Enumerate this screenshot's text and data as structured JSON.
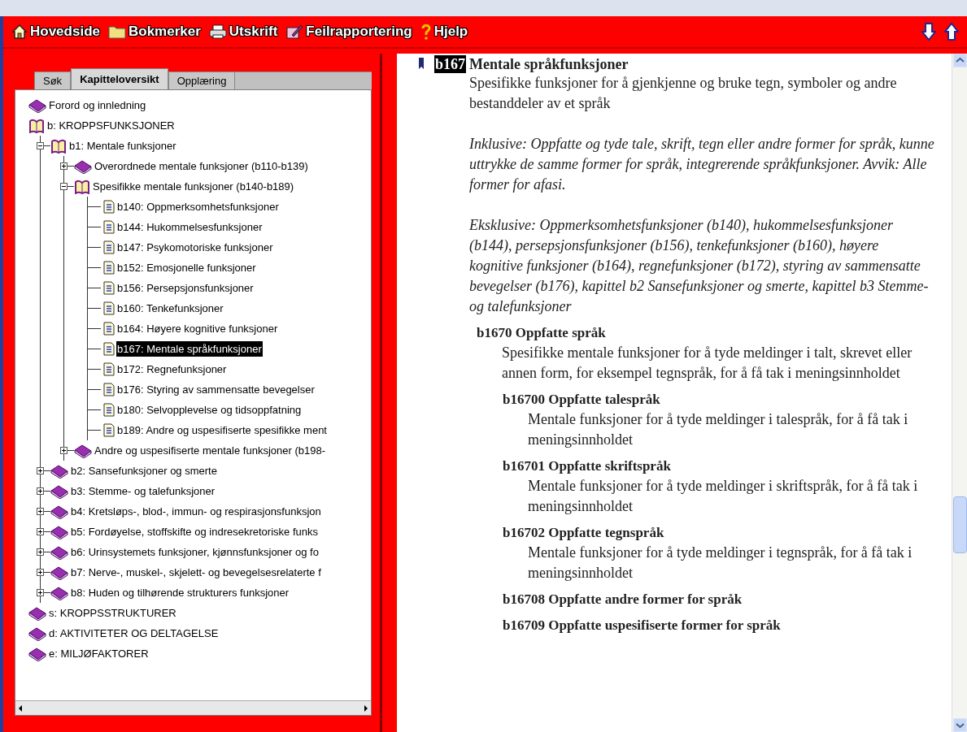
{
  "toolbar": {
    "items": [
      {
        "kind": "home",
        "label": "Hovedside"
      },
      {
        "kind": "folder",
        "label": "Bokmerker"
      },
      {
        "kind": "print",
        "label": "Utskrift"
      },
      {
        "kind": "report",
        "label": "Feilrapportering"
      },
      {
        "kind": "help",
        "label": "Hjelp"
      }
    ]
  },
  "tabs": [
    {
      "label": "Søk",
      "selected": false
    },
    {
      "label": "Kapitteloversikt",
      "selected": true
    },
    {
      "label": "Opplæring",
      "selected": false
    }
  ],
  "tree": [
    {
      "kind": "book",
      "label": "Forord og innledning",
      "expanded": false,
      "selected": false
    },
    {
      "kind": "book",
      "label": "b: KROPPSFUNKSJONER",
      "expanded": true,
      "selected": false,
      "children": [
        {
          "kind": "book",
          "label": "b1: Mentale funksjoner",
          "expanded": true,
          "selected": false,
          "children": [
            {
              "kind": "book",
              "label": "Overordnede mentale funksjoner (b110-b139)",
              "expanded": false,
              "selected": false
            },
            {
              "kind": "book",
              "label": "Spesifikke mentale funksjoner (b140-b189)",
              "expanded": true,
              "selected": false,
              "children": [
                {
                  "kind": "page",
                  "label": "b140: Oppmerksomhetsfunksjoner",
                  "selected": false
                },
                {
                  "kind": "page",
                  "label": "b144: Hukommelsesfunksjoner",
                  "selected": false
                },
                {
                  "kind": "page",
                  "label": "b147: Psykomotoriske funksjoner",
                  "selected": false
                },
                {
                  "kind": "page",
                  "label": "b152: Emosjonelle funksjoner",
                  "selected": false
                },
                {
                  "kind": "page",
                  "label": "b156: Persepsjonsfunksjoner",
                  "selected": false
                },
                {
                  "kind": "page",
                  "label": "b160: Tenkefunksjoner",
                  "selected": false
                },
                {
                  "kind": "page",
                  "label": "b164: Høyere kognitive funksjoner",
                  "selected": false
                },
                {
                  "kind": "page",
                  "label": "b167: Mentale språkfunksjoner",
                  "selected": true
                },
                {
                  "kind": "page",
                  "label": "b172: Regnefunksjoner",
                  "selected": false
                },
                {
                  "kind": "page",
                  "label": "b176: Styring av sammensatte bevegelser",
                  "selected": false
                },
                {
                  "kind": "page",
                  "label": "b180: Selvopplevelse og tidsoppfatning",
                  "selected": false
                },
                {
                  "kind": "page",
                  "label": "b189: Andre og uspesifiserte spesifikke ment",
                  "selected": false
                }
              ]
            },
            {
              "kind": "book",
              "label": "Andre og uspesifiserte mentale funksjoner (b198-",
              "expanded": false,
              "selected": false
            }
          ]
        },
        {
          "kind": "book",
          "label": "b2: Sansefunksjoner og smerte",
          "expanded": false,
          "selected": false
        },
        {
          "kind": "book",
          "label": "b3: Stemme- og talefunksjoner",
          "expanded": false,
          "selected": false
        },
        {
          "kind": "book",
          "label": "b4: Kretsløps-, blod-, immun- og respirasjonsfunksjon",
          "expanded": false,
          "selected": false
        },
        {
          "kind": "book",
          "label": "b5: Fordøyelse, stoffskifte og indresekretoriske funks",
          "expanded": false,
          "selected": false
        },
        {
          "kind": "book",
          "label": "b6: Urinsystemets funksjoner, kjønnsfunksjoner og fo",
          "expanded": false,
          "selected": false
        },
        {
          "kind": "book",
          "label": "b7: Nerve-, muskel-, skjelett- og bevegelsesrelaterte f",
          "expanded": false,
          "selected": false
        },
        {
          "kind": "book",
          "label": "b8: Huden og tilhørende strukturers funksjoner",
          "expanded": false,
          "selected": false
        }
      ]
    },
    {
      "kind": "book",
      "label": "s: KROPPSSTRUKTURER",
      "expanded": false,
      "selected": false
    },
    {
      "kind": "book",
      "label": "d: AKTIVITETER OG DELTAGELSE",
      "expanded": false,
      "selected": false
    },
    {
      "kind": "book",
      "label": "e: MILJØFAKTORER",
      "expanded": false,
      "selected": false
    }
  ],
  "article": {
    "code": "b167",
    "title": "Mentale språkfunksjoner",
    "description": "Spesifikke funksjoner for å gjenkjenne og bruke tegn, symboler og andre bestanddeler av et språk",
    "notes": [
      "Inklusive: Oppfatte og tyde tale, skrift, tegn eller andre former for språk, kunne uttrykke de samme former for språk, integrerende språkfunksjoner. Avvik: Alle former for afasi.",
      "Eksklusive: Oppmerksomhetsfunksjoner (b140), hukommelsesfunksjoner (b144), persepsjonsfunksjoner (b156), tenkefunksjoner (b160), høyere kognitive funksjoner (b164), regnefunksjoner (b172), styring av sammensatte bevegelser (b176), kapittel b2 Sansefunksjoner og smerte, kapittel b3 Stemme- og talefunksjoner"
    ],
    "subsections": [
      {
        "code": "b1670",
        "title": "Oppfatte språk",
        "description": "Spesifikke mentale funksjoner for å tyde meldinger i talt, skrevet eller annen form, for eksempel tegnspråk, for å få tak i meningsinnholdet",
        "children": [
          {
            "code": "b16700",
            "title": "Oppfatte talespråk",
            "description": "Mentale funksjoner for å tyde meldinger i talespråk, for å få tak i meningsinnholdet"
          },
          {
            "code": "b16701",
            "title": "Oppfatte skriftspråk",
            "description": "Mentale funksjoner for å tyde meldinger i skriftspråk, for å få tak i meningsinnholdet"
          },
          {
            "code": "b16702",
            "title": "Oppfatte tegnspråk",
            "description": "Mentale funksjoner for å tyde meldinger i tegnspråk, for å få tak i meningsinnholdet"
          },
          {
            "code": "b16708",
            "title": "Oppfatte andre former for språk"
          },
          {
            "code": "b16709",
            "title": "Oppfatte uspesifiserte former for språk"
          }
        ]
      }
    ]
  }
}
